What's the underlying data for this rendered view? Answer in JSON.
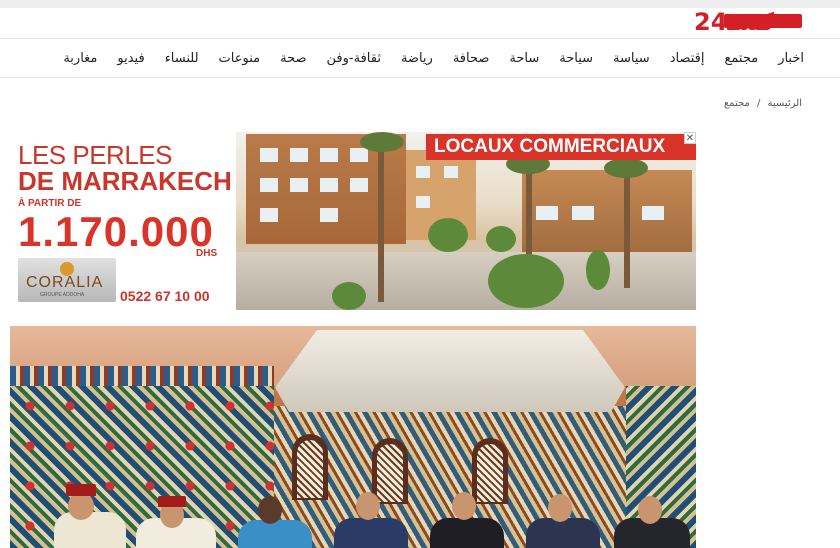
{
  "header": {
    "logo_text": "24كشـ",
    "brand_color": "#d32027"
  },
  "nav": {
    "items": [
      "اخبار",
      "مجتمع",
      "إقتصاد",
      "سياسة",
      "سياحة",
      "ساحة",
      "صحافة",
      "رياضة",
      "ثقافة-وفن",
      "صحة",
      "منوعات",
      "للنساء",
      "فيديو",
      "مغاربة"
    ]
  },
  "breadcrumb": {
    "home": "الرئيسية",
    "separator": "/",
    "current": "مجتمع"
  },
  "ad": {
    "title_line1": "LES PERLES",
    "title_line2": "DE MARRAKECH",
    "from_label": "À PARTIR DE",
    "price": "1.170.000",
    "currency": "DHS",
    "brand": "CORALIA",
    "brand_sub": "GROUPE ADDOHA",
    "phone": "0522 67 10 00",
    "banner": "LOCAUX COMMERCIAUX",
    "close_icon": "✕",
    "accent": "#d9342a"
  }
}
